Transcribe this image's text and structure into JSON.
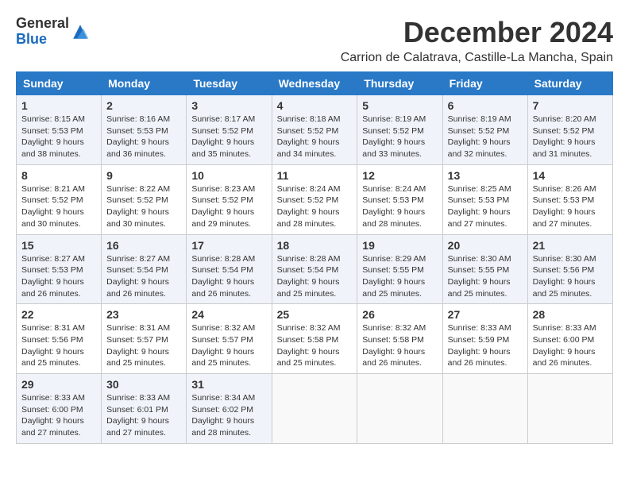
{
  "logo": {
    "general": "General",
    "blue": "Blue"
  },
  "title": "December 2024",
  "location": "Carrion de Calatrava, Castille-La Mancha, Spain",
  "weekdays": [
    "Sunday",
    "Monday",
    "Tuesday",
    "Wednesday",
    "Thursday",
    "Friday",
    "Saturday"
  ],
  "weeks": [
    [
      {
        "day": "1",
        "sunrise": "Sunrise: 8:15 AM",
        "sunset": "Sunset: 5:53 PM",
        "daylight": "Daylight: 9 hours and 38 minutes."
      },
      {
        "day": "2",
        "sunrise": "Sunrise: 8:16 AM",
        "sunset": "Sunset: 5:53 PM",
        "daylight": "Daylight: 9 hours and 36 minutes."
      },
      {
        "day": "3",
        "sunrise": "Sunrise: 8:17 AM",
        "sunset": "Sunset: 5:52 PM",
        "daylight": "Daylight: 9 hours and 35 minutes."
      },
      {
        "day": "4",
        "sunrise": "Sunrise: 8:18 AM",
        "sunset": "Sunset: 5:52 PM",
        "daylight": "Daylight: 9 hours and 34 minutes."
      },
      {
        "day": "5",
        "sunrise": "Sunrise: 8:19 AM",
        "sunset": "Sunset: 5:52 PM",
        "daylight": "Daylight: 9 hours and 33 minutes."
      },
      {
        "day": "6",
        "sunrise": "Sunrise: 8:19 AM",
        "sunset": "Sunset: 5:52 PM",
        "daylight": "Daylight: 9 hours and 32 minutes."
      },
      {
        "day": "7",
        "sunrise": "Sunrise: 8:20 AM",
        "sunset": "Sunset: 5:52 PM",
        "daylight": "Daylight: 9 hours and 31 minutes."
      }
    ],
    [
      {
        "day": "8",
        "sunrise": "Sunrise: 8:21 AM",
        "sunset": "Sunset: 5:52 PM",
        "daylight": "Daylight: 9 hours and 30 minutes."
      },
      {
        "day": "9",
        "sunrise": "Sunrise: 8:22 AM",
        "sunset": "Sunset: 5:52 PM",
        "daylight": "Daylight: 9 hours and 30 minutes."
      },
      {
        "day": "10",
        "sunrise": "Sunrise: 8:23 AM",
        "sunset": "Sunset: 5:52 PM",
        "daylight": "Daylight: 9 hours and 29 minutes."
      },
      {
        "day": "11",
        "sunrise": "Sunrise: 8:24 AM",
        "sunset": "Sunset: 5:52 PM",
        "daylight": "Daylight: 9 hours and 28 minutes."
      },
      {
        "day": "12",
        "sunrise": "Sunrise: 8:24 AM",
        "sunset": "Sunset: 5:53 PM",
        "daylight": "Daylight: 9 hours and 28 minutes."
      },
      {
        "day": "13",
        "sunrise": "Sunrise: 8:25 AM",
        "sunset": "Sunset: 5:53 PM",
        "daylight": "Daylight: 9 hours and 27 minutes."
      },
      {
        "day": "14",
        "sunrise": "Sunrise: 8:26 AM",
        "sunset": "Sunset: 5:53 PM",
        "daylight": "Daylight: 9 hours and 27 minutes."
      }
    ],
    [
      {
        "day": "15",
        "sunrise": "Sunrise: 8:27 AM",
        "sunset": "Sunset: 5:53 PM",
        "daylight": "Daylight: 9 hours and 26 minutes."
      },
      {
        "day": "16",
        "sunrise": "Sunrise: 8:27 AM",
        "sunset": "Sunset: 5:54 PM",
        "daylight": "Daylight: 9 hours and 26 minutes."
      },
      {
        "day": "17",
        "sunrise": "Sunrise: 8:28 AM",
        "sunset": "Sunset: 5:54 PM",
        "daylight": "Daylight: 9 hours and 26 minutes."
      },
      {
        "day": "18",
        "sunrise": "Sunrise: 8:28 AM",
        "sunset": "Sunset: 5:54 PM",
        "daylight": "Daylight: 9 hours and 25 minutes."
      },
      {
        "day": "19",
        "sunrise": "Sunrise: 8:29 AM",
        "sunset": "Sunset: 5:55 PM",
        "daylight": "Daylight: 9 hours and 25 minutes."
      },
      {
        "day": "20",
        "sunrise": "Sunrise: 8:30 AM",
        "sunset": "Sunset: 5:55 PM",
        "daylight": "Daylight: 9 hours and 25 minutes."
      },
      {
        "day": "21",
        "sunrise": "Sunrise: 8:30 AM",
        "sunset": "Sunset: 5:56 PM",
        "daylight": "Daylight: 9 hours and 25 minutes."
      }
    ],
    [
      {
        "day": "22",
        "sunrise": "Sunrise: 8:31 AM",
        "sunset": "Sunset: 5:56 PM",
        "daylight": "Daylight: 9 hours and 25 minutes."
      },
      {
        "day": "23",
        "sunrise": "Sunrise: 8:31 AM",
        "sunset": "Sunset: 5:57 PM",
        "daylight": "Daylight: 9 hours and 25 minutes."
      },
      {
        "day": "24",
        "sunrise": "Sunrise: 8:32 AM",
        "sunset": "Sunset: 5:57 PM",
        "daylight": "Daylight: 9 hours and 25 minutes."
      },
      {
        "day": "25",
        "sunrise": "Sunrise: 8:32 AM",
        "sunset": "Sunset: 5:58 PM",
        "daylight": "Daylight: 9 hours and 25 minutes."
      },
      {
        "day": "26",
        "sunrise": "Sunrise: 8:32 AM",
        "sunset": "Sunset: 5:58 PM",
        "daylight": "Daylight: 9 hours and 26 minutes."
      },
      {
        "day": "27",
        "sunrise": "Sunrise: 8:33 AM",
        "sunset": "Sunset: 5:59 PM",
        "daylight": "Daylight: 9 hours and 26 minutes."
      },
      {
        "day": "28",
        "sunrise": "Sunrise: 8:33 AM",
        "sunset": "Sunset: 6:00 PM",
        "daylight": "Daylight: 9 hours and 26 minutes."
      }
    ],
    [
      {
        "day": "29",
        "sunrise": "Sunrise: 8:33 AM",
        "sunset": "Sunset: 6:00 PM",
        "daylight": "Daylight: 9 hours and 27 minutes."
      },
      {
        "day": "30",
        "sunrise": "Sunrise: 8:33 AM",
        "sunset": "Sunset: 6:01 PM",
        "daylight": "Daylight: 9 hours and 27 minutes."
      },
      {
        "day": "31",
        "sunrise": "Sunrise: 8:34 AM",
        "sunset": "Sunset: 6:02 PM",
        "daylight": "Daylight: 9 hours and 28 minutes."
      },
      null,
      null,
      null,
      null
    ]
  ]
}
